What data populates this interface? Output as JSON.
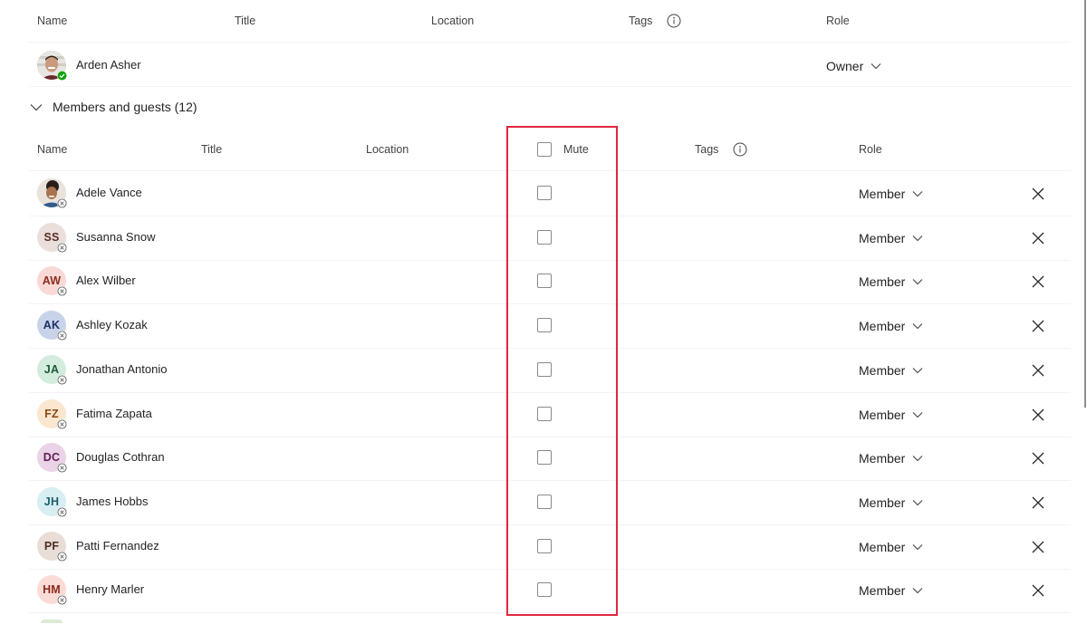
{
  "owners_table": {
    "headers": {
      "name": "Name",
      "title": "Title",
      "location": "Location",
      "tags": "Tags",
      "role": "Role"
    },
    "rows": [
      {
        "name": "Arden Asher",
        "role": "Owner",
        "avatar_type": "photo",
        "status": "available"
      }
    ]
  },
  "members_section": {
    "label": "Members and guests (12)",
    "expanded": true
  },
  "members_table": {
    "headers": {
      "name": "Name",
      "title": "Title",
      "location": "Location",
      "mute": "Mute",
      "tags": "Tags",
      "role": "Role"
    },
    "mute_all_checked": false,
    "rows": [
      {
        "name": "Adele Vance",
        "initials": "",
        "avatar_type": "photo",
        "bg": "#c9b7a8",
        "fg": "#3b2a1e",
        "muted": false,
        "role": "Member"
      },
      {
        "name": "Susanna Snow",
        "initials": "SS",
        "avatar_type": "initials",
        "bg": "#eadfdb",
        "fg": "#5a2d23",
        "muted": false,
        "role": "Member"
      },
      {
        "name": "Alex Wilber",
        "initials": "AW",
        "avatar_type": "initials",
        "bg": "#f9d9d6",
        "fg": "#8a2c20",
        "muted": false,
        "role": "Member"
      },
      {
        "name": "Ashley Kozak",
        "initials": "AK",
        "avatar_type": "initials",
        "bg": "#c8d3ea",
        "fg": "#1f2f62",
        "muted": false,
        "role": "Member"
      },
      {
        "name": "Jonathan Antonio",
        "initials": "JA",
        "avatar_type": "initials",
        "bg": "#d3ecdd",
        "fg": "#1b5a36",
        "muted": false,
        "role": "Member"
      },
      {
        "name": "Fatima Zapata",
        "initials": "FZ",
        "avatar_type": "initials",
        "bg": "#fbe6d0",
        "fg": "#8a4a12",
        "muted": false,
        "role": "Member"
      },
      {
        "name": "Douglas Cothran",
        "initials": "DC",
        "avatar_type": "initials",
        "bg": "#ead3e6",
        "fg": "#5e1f55",
        "muted": false,
        "role": "Member"
      },
      {
        "name": "James Hobbs",
        "initials": "JH",
        "avatar_type": "initials",
        "bg": "#d7eef2",
        "fg": "#1d5f68",
        "muted": false,
        "role": "Member"
      },
      {
        "name": "Patti Fernandez",
        "initials": "PF",
        "avatar_type": "initials",
        "bg": "#e9ddd8",
        "fg": "#4e2b21",
        "muted": false,
        "role": "Member"
      },
      {
        "name": "Henry Marler",
        "initials": "HM",
        "avatar_type": "initials",
        "bg": "#fadbd6",
        "fg": "#8c2a1f",
        "muted": false,
        "role": "Member"
      }
    ]
  },
  "icons": {
    "info": "info-icon",
    "chevron": "chevron-down-icon",
    "remove": "close-icon",
    "status_available": "check-circle-icon",
    "status_offline": "x-circle-icon"
  },
  "colors": {
    "highlight": "#e1263f",
    "available_green": "#13a10e"
  }
}
